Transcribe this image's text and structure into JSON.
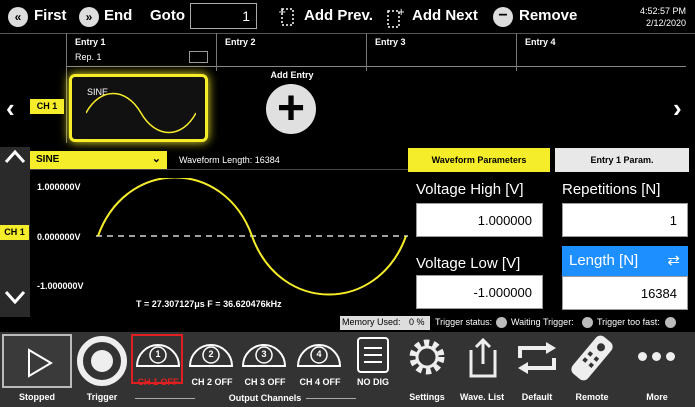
{
  "toolbar": {
    "first_label": "First",
    "end_label": "End",
    "goto_label": "Goto",
    "goto_value": "1",
    "add_prev_label": "Add Prev.",
    "add_next_label": "Add Next",
    "remove_label": "Remove",
    "time": "4:52:57 PM",
    "date": "2/12/2020"
  },
  "timeline": {
    "entries": [
      {
        "label": "Entry  1",
        "rep": "Rep.  1"
      },
      {
        "label": "Entry  2"
      },
      {
        "label": "Entry  3"
      },
      {
        "label": "Entry  4"
      }
    ],
    "channel_badge": "CH 1",
    "waveform_card_label": "SINE",
    "add_entry_label": "Add Entry"
  },
  "waveform": {
    "type_selected": "SINE",
    "length_label": "Waveform Length:  16384",
    "v_high": "1.000000V",
    "v_zero": "0.000000V",
    "v_low": "-1.000000V",
    "period_info": "T =  27.307127μs   F =  36.620476kHz",
    "channel_badge": "CH 1"
  },
  "tabs": {
    "waveform_params": "Waveform Parameters",
    "entry_params": "Entry  1  Param."
  },
  "params": {
    "voltage_high_label": "Voltage High [V]",
    "voltage_high_value": "1.000000",
    "voltage_low_label": "Voltage Low [V]",
    "voltage_low_value": "-1.000000",
    "repetitions_label": "Repetitions [N]",
    "repetitions_value": "1",
    "length_label": "Length [N]",
    "length_value": "16384"
  },
  "status": {
    "memory_label": "Memory Used:",
    "memory_value": "0 %",
    "trigger_status": "Trigger status:",
    "waiting_trigger": "Waiting Trigger:",
    "trigger_too_fast": "Trigger too fast:"
  },
  "bottom": {
    "stopped": "Stopped",
    "trigger": "Trigger",
    "output_channels": "Output Channels",
    "ch1": "CH 1 OFF",
    "ch2": "CH 2 OFF",
    "ch3": "CH 3 OFF",
    "ch4": "CH 4 OFF",
    "ch1_num": "1",
    "ch2_num": "2",
    "ch3_num": "3",
    "ch4_num": "4",
    "no_dig": "NO DIG",
    "settings": "Settings",
    "wave_list": "Wave. List",
    "default": "Default",
    "remote": "Remote",
    "more": "More"
  },
  "colors": {
    "accent_yellow": "#f5ed2a",
    "accent_blue": "#1e8fff",
    "alert_red": "#e02020"
  }
}
